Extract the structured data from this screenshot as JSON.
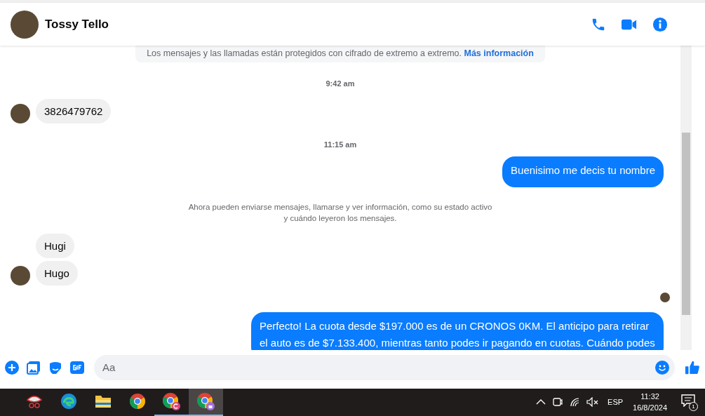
{
  "header": {
    "name": "Tossy Tello"
  },
  "messages": [
    {
      "kind": "notice",
      "text": "Los mensajes y las llamadas están protegidos con cifrado de extremo a extremo.",
      "link": "Más información"
    },
    {
      "kind": "time",
      "text": "9:42 am"
    },
    {
      "kind": "incoming",
      "texts": [
        "3826479762"
      ]
    },
    {
      "kind": "time",
      "text": "11:15 am"
    },
    {
      "kind": "outgoing",
      "texts": [
        "Buenisimo me decis tu nombre"
      ]
    },
    {
      "kind": "info",
      "text": "Ahora pueden enviarse mensajes, llamarse y ver información, como su estado activo y cuándo leyeron los mensajes."
    },
    {
      "kind": "incoming",
      "texts": [
        "Hugi",
        "Hugo"
      ]
    },
    {
      "kind": "seen"
    },
    {
      "kind": "outgoing",
      "texts": [
        "Perfecto! La cuota desde $197.000 es de un CRONOS 0KM. El anticipo para retirar el auto es de $7.133.400, mientras tanto podes ir pagando en cuotas. Cuándo podes"
      ]
    }
  ],
  "composer": {
    "placeholder": "Aa"
  },
  "taskbar": {
    "apps": [
      {
        "kind": "snip",
        "running": false,
        "selected": false
      },
      {
        "kind": "edge",
        "running": false,
        "selected": false
      },
      {
        "kind": "folder",
        "running": false,
        "selected": false
      },
      {
        "kind": "chrome",
        "running": false,
        "selected": false
      },
      {
        "kind": "chrome-c",
        "running": true,
        "selected": false
      },
      {
        "kind": "chrome-lock",
        "running": true,
        "selected": true
      }
    ],
    "language": "ESP",
    "time": "11:32",
    "date": "16/8/2024",
    "notifications": "1"
  }
}
